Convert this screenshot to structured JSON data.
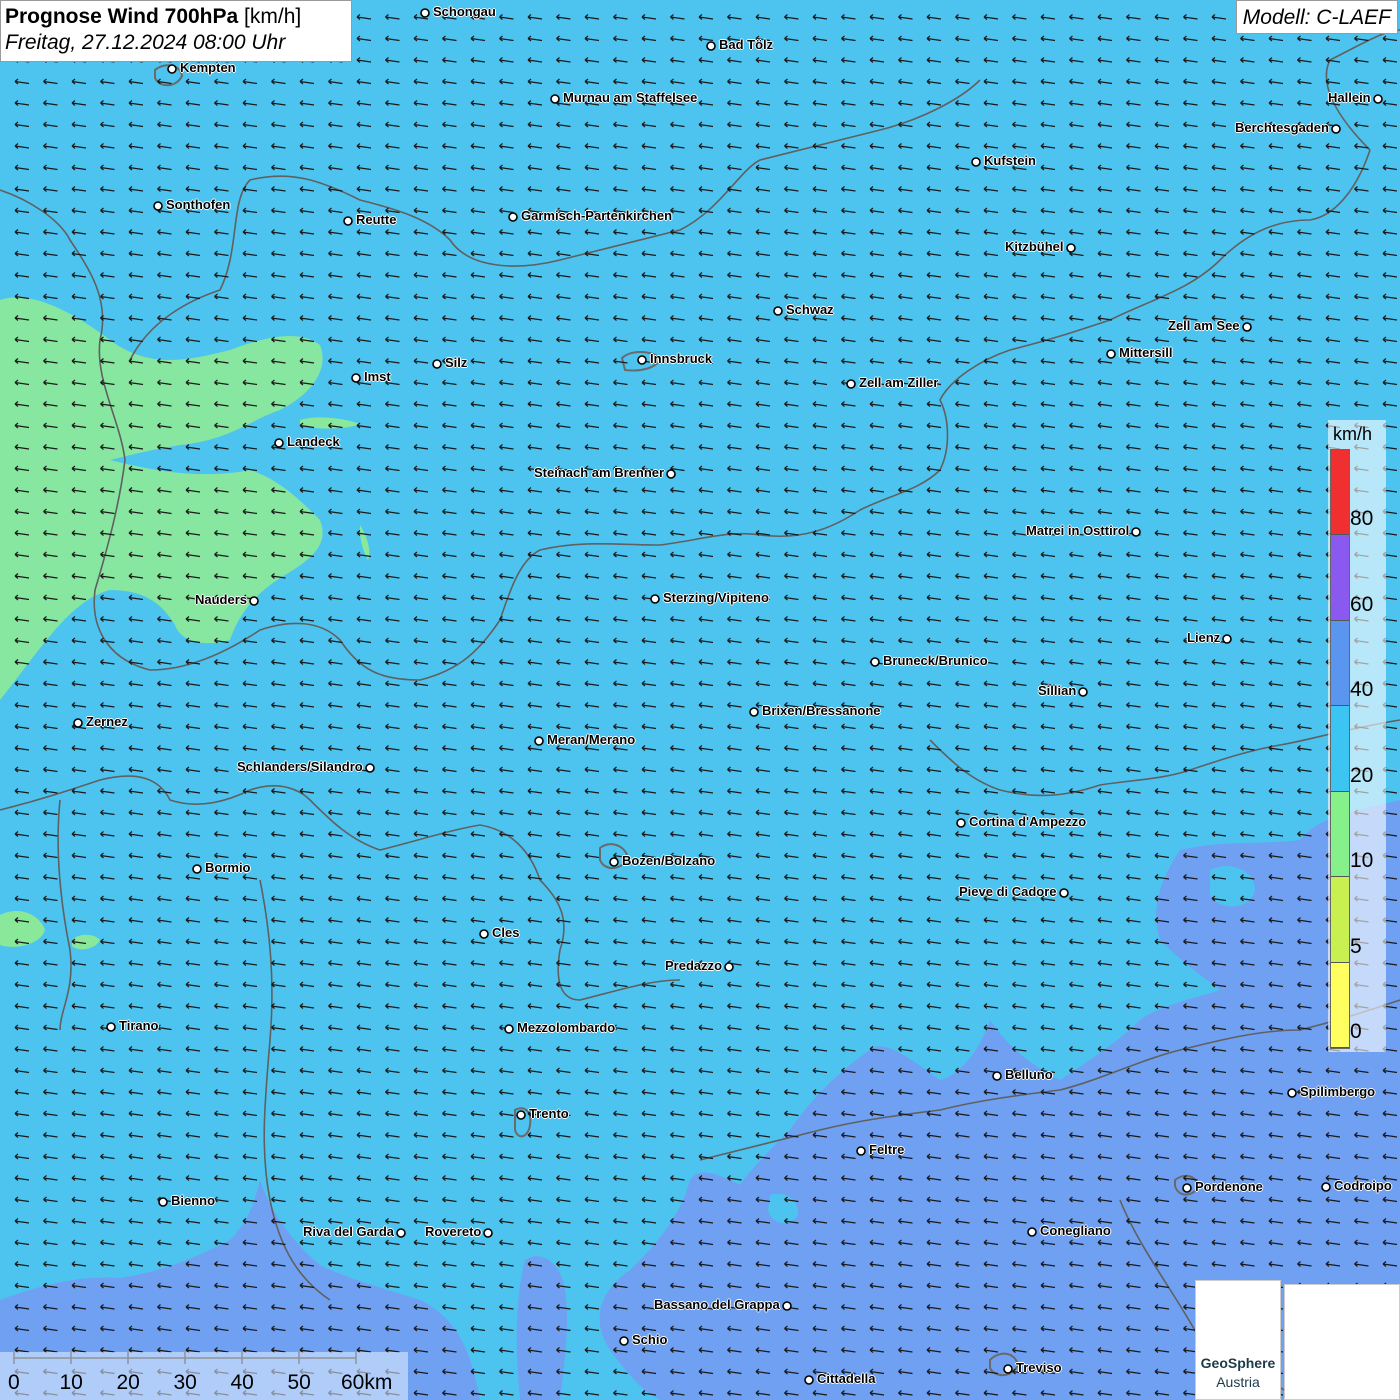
{
  "header": {
    "title_bold": "Prognose Wind 700hPa",
    "title_unit": "[km/h]",
    "datetime": "Freitag, 27.12.2024 08:00 Uhr",
    "model": "Modell: C-LAEF"
  },
  "legend": {
    "unit": "km/h",
    "labels": [
      "80",
      "60",
      "40",
      "20",
      "10",
      "5",
      "0"
    ],
    "colors": [
      "#f03030",
      "#8a5af0",
      "#5a96f0",
      "#3cc4f2",
      "#86f08a",
      "#c8f050",
      "#ffff60"
    ]
  },
  "scale_bar": {
    "labels": [
      "0",
      "10",
      "20",
      "30",
      "40",
      "50",
      "60km"
    ]
  },
  "colors": {
    "background_wind": "#4dc4f0",
    "calm_zone": "#8ae89a",
    "strong_zone": "#6fa0f2",
    "border": "#606060"
  },
  "logos": {
    "geosphere_line1": "GeoSphere",
    "geosphere_line2": "Austria",
    "geosphere_icon": "geosphere-logo-icon",
    "second_icon": "cloud-roof-logo-icon"
  },
  "wind": {
    "direction": "from east (arrows pointing west)"
  },
  "cities": [
    {
      "name": "Schongau",
      "label": "Schongau",
      "anchor": "right"
    },
    {
      "name": "Bad Tölz",
      "label": "Bad Tölz",
      "anchor": "right"
    },
    {
      "name": "Kempten",
      "label": "Kempten",
      "anchor": "right"
    },
    {
      "name": "Murnau am Staffelsee",
      "label": "Murnau am Staffelsee",
      "anchor": "right"
    },
    {
      "name": "Hallein",
      "label": "Hallein",
      "anchor": "left"
    },
    {
      "name": "Berchtesgaden",
      "label": "Berchtesgaden",
      "anchor": "left"
    },
    {
      "name": "Kufstein",
      "label": "Kufstein",
      "anchor": "right"
    },
    {
      "name": "Sonthofen",
      "label": "Sonthofen",
      "anchor": "right"
    },
    {
      "name": "Reutte",
      "label": "Reutte",
      "anchor": "right"
    },
    {
      "name": "Garmisch-Partenkirchen",
      "label": "Garmisch-Partenkirchen",
      "anchor": "right"
    },
    {
      "name": "Kitzbühel",
      "label": "Kitzbühel",
      "anchor": "left"
    },
    {
      "name": "Schwaz",
      "label": "Schwaz",
      "anchor": "right"
    },
    {
      "name": "Zell am See",
      "label": "Zell am See",
      "anchor": "left"
    },
    {
      "name": "Mittersill",
      "label": "Mittersill",
      "anchor": "right"
    },
    {
      "name": "Innsbruck",
      "label": "Innsbruck",
      "anchor": "right"
    },
    {
      "name": "Silz",
      "label": "Silz",
      "anchor": "right"
    },
    {
      "name": "Imst",
      "label": "Imst",
      "anchor": "right"
    },
    {
      "name": "Zell am Ziller",
      "label": "Zell am Ziller",
      "anchor": "right"
    },
    {
      "name": "Landeck",
      "label": "Landeck",
      "anchor": "right"
    },
    {
      "name": "Steinach am Brenner",
      "label": "Steinach am Brenner",
      "anchor": "left"
    },
    {
      "name": "Matrei in Osttirol",
      "label": "Matrei in Osttirol",
      "anchor": "left"
    },
    {
      "name": "Nauders",
      "label": "Nauders",
      "anchor": "left"
    },
    {
      "name": "Sterzing/Vipiteno",
      "label": "Sterzing/Vipiteno",
      "anchor": "right"
    },
    {
      "name": "Lienz",
      "label": "Lienz",
      "anchor": "left"
    },
    {
      "name": "Bruneck/Brunico",
      "label": "Bruneck/Brunico",
      "anchor": "right"
    },
    {
      "name": "Sillian",
      "label": "Sillian",
      "anchor": "left"
    },
    {
      "name": "Brixen/Bressanone",
      "label": "Brixen/Bressanone",
      "anchor": "right"
    },
    {
      "name": "Zernez",
      "label": "Zernez",
      "anchor": "right"
    },
    {
      "name": "Meran/Merano",
      "label": "Meran/Merano",
      "anchor": "right"
    },
    {
      "name": "Schlanders/Silandro",
      "label": "Schlanders/Silandro",
      "anchor": "left"
    },
    {
      "name": "Cortina d'Ampezzo",
      "label": "Cortina d'Ampezzo",
      "anchor": "right"
    },
    {
      "name": "Bozen/Bolzano",
      "label": "Bozen/Bolzano",
      "anchor": "right"
    },
    {
      "name": "Bormio",
      "label": "Bormio",
      "anchor": "right"
    },
    {
      "name": "Pieve di Cadore",
      "label": "Pieve di Cadore",
      "anchor": "left"
    },
    {
      "name": "Cles",
      "label": "Cles",
      "anchor": "right"
    },
    {
      "name": "Predazzo",
      "label": "Predazzo",
      "anchor": "left"
    },
    {
      "name": "Tirano",
      "label": "Tirano",
      "anchor": "right"
    },
    {
      "name": "Mezzolombardo",
      "label": "Mezzolombardo",
      "anchor": "right"
    },
    {
      "name": "Belluno",
      "label": "Belluno",
      "anchor": "right"
    },
    {
      "name": "Spilimbergo",
      "label": "Spilimbergo",
      "anchor": "right"
    },
    {
      "name": "Trento",
      "label": "Trento",
      "anchor": "right"
    },
    {
      "name": "Feltre",
      "label": "Feltre",
      "anchor": "right"
    },
    {
      "name": "Pordenone",
      "label": "Pordenone",
      "anchor": "right"
    },
    {
      "name": "Codroipo",
      "label": "Codroipo",
      "anchor": "right"
    },
    {
      "name": "Bienno",
      "label": "Bienno",
      "anchor": "right"
    },
    {
      "name": "Riva del Garda",
      "label": "Riva del Garda",
      "anchor": "left"
    },
    {
      "name": "Rovereto",
      "label": "Rovereto",
      "anchor": "left"
    },
    {
      "name": "Conegliano",
      "label": "Conegliano",
      "anchor": "right"
    },
    {
      "name": "Bassano del Grappa",
      "label": "Bassano del Grappa",
      "anchor": "left"
    },
    {
      "name": "Schio",
      "label": "Schio",
      "anchor": "right"
    },
    {
      "name": "Treviso",
      "label": "Treviso",
      "anchor": "right"
    },
    {
      "name": "Cittadella",
      "label": "Cittadella",
      "anchor": "right"
    }
  ]
}
